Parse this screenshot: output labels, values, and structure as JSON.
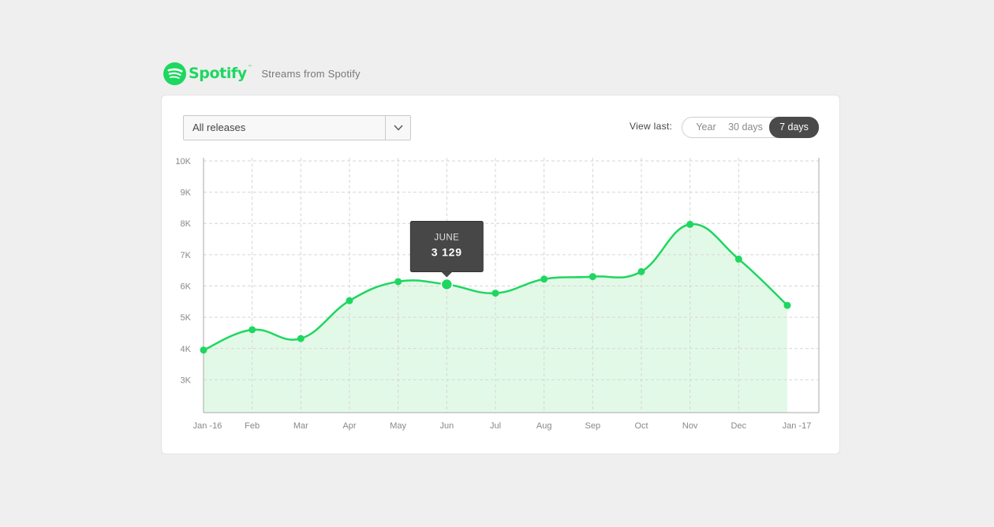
{
  "brand": {
    "logo_name": "spotify-logo-icon",
    "wordmark": "Spotify",
    "subtitle": "Streams from Spotify",
    "accent_color": "#1ed760"
  },
  "controls": {
    "release_select_value": "All releases",
    "view_last_label": "View last:",
    "view_options": [
      "Year",
      "30 days",
      "7 days"
    ],
    "view_selected": "7 days"
  },
  "tooltip": {
    "month": "JUNE",
    "value": "3 129"
  },
  "chart_data": {
    "type": "area",
    "x_labels": [
      "Jan -16",
      "Feb",
      "Mar",
      "Apr",
      "May",
      "Jun",
      "Jul",
      "Aug",
      "Sep",
      "Oct",
      "Nov",
      "Dec",
      "Jan -17"
    ],
    "series": [
      {
        "values": [
          3950,
          4600,
          4320,
          5530,
          6140,
          6050,
          5770,
          6220,
          6300,
          6460,
          7970,
          6860,
          5380
        ]
      }
    ],
    "highlighted_index": 5,
    "y_ticks": [
      "10K",
      "9K",
      "8K",
      "7K",
      "6K",
      "5K",
      "4K",
      "3K"
    ],
    "y_tick_values": [
      10000,
      9000,
      8000,
      7000,
      6000,
      5000,
      4000,
      3000
    ],
    "ylim": [
      1950,
      10100
    ],
    "grid": true,
    "line_color": "#1ed760",
    "fill_color": "#e3f9e8"
  }
}
